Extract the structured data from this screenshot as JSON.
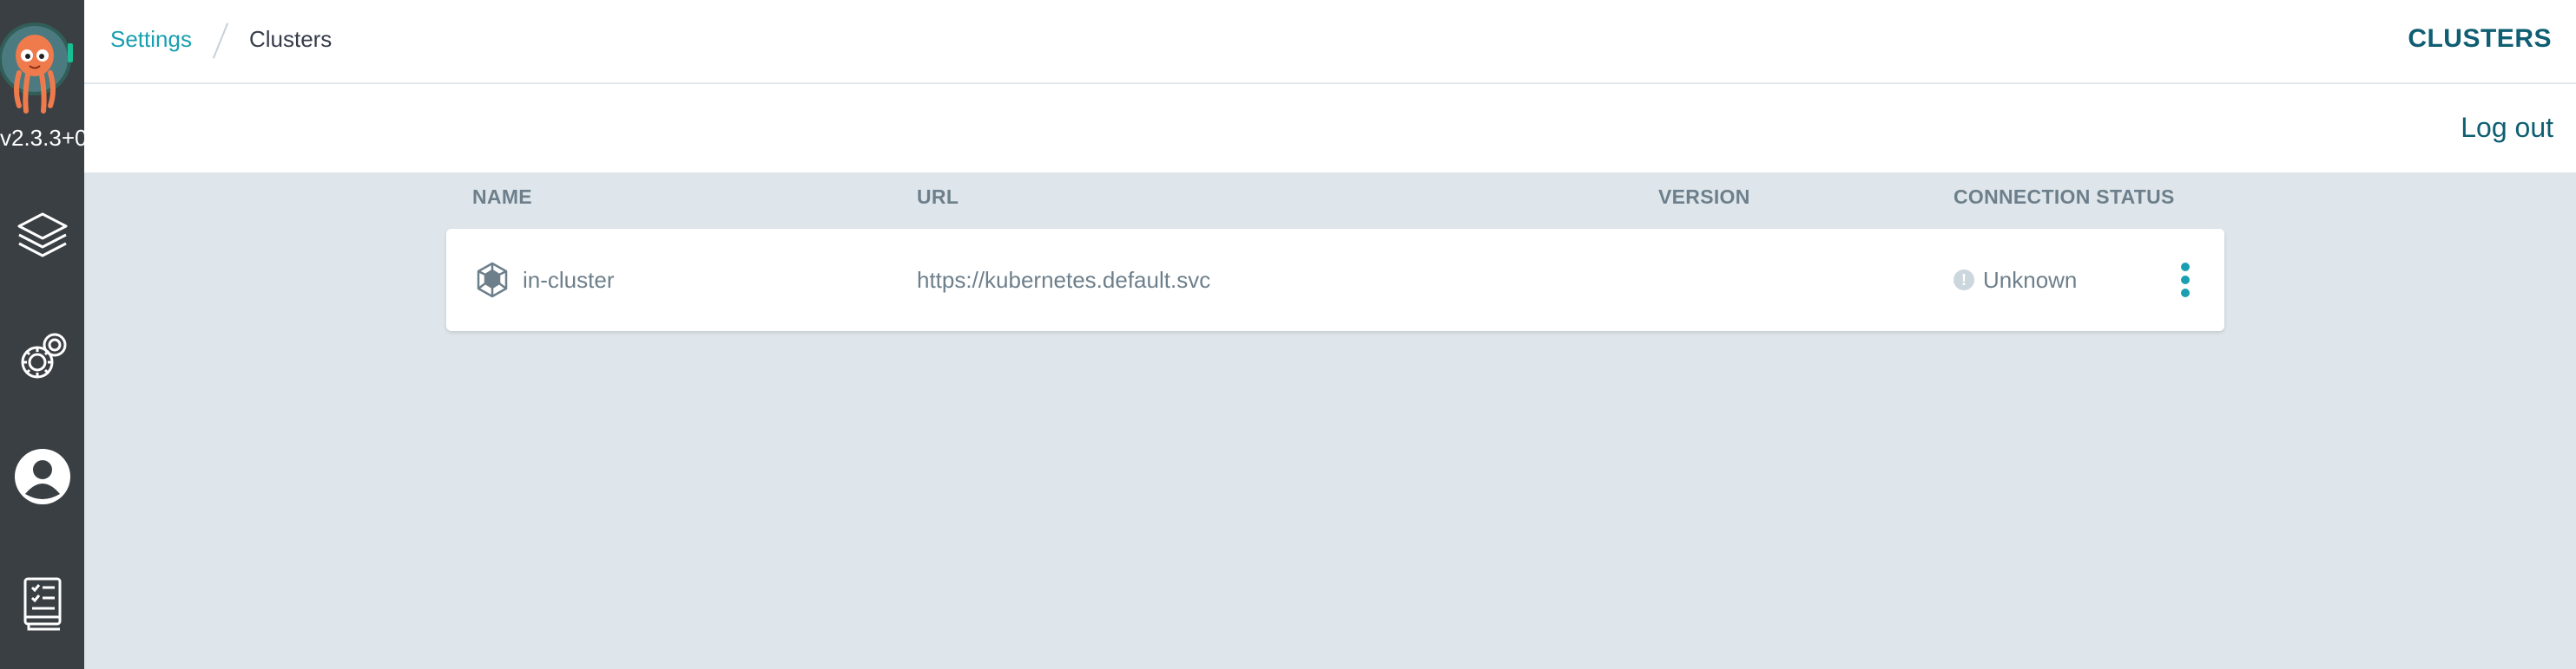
{
  "sidebar": {
    "version": "v2.3.3+0",
    "items": [
      {
        "icon": "layers-icon"
      },
      {
        "icon": "gear-icon"
      },
      {
        "icon": "user-icon"
      },
      {
        "icon": "docs-icon"
      }
    ]
  },
  "header": {
    "breadcrumb": {
      "parent": "Settings",
      "current": "Clusters"
    },
    "title": "CLUSTERS"
  },
  "actions": {
    "logout": "Log out"
  },
  "table": {
    "columns": [
      "NAME",
      "URL",
      "VERSION",
      "CONNECTION STATUS"
    ],
    "rows": [
      {
        "name": "in-cluster",
        "url": "https://kubernetes.default.svc",
        "version": "",
        "status": "Unknown"
      }
    ]
  },
  "colors": {
    "sidebar": "#3a3f44",
    "accent": "#1a9fb0",
    "heading": "#0f5e72",
    "background": "#dee6eb"
  }
}
